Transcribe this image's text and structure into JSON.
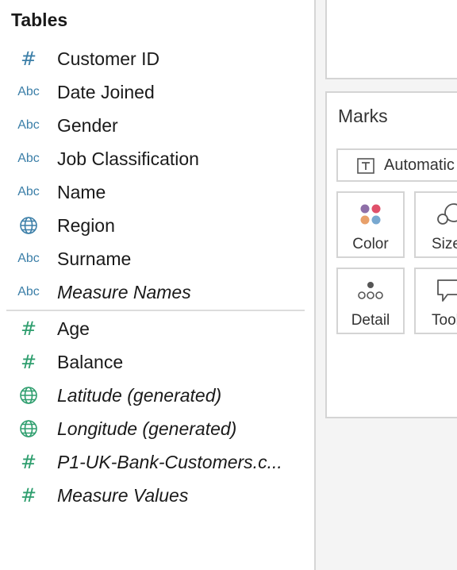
{
  "data_pane": {
    "header": "Tables",
    "dimensions": [
      {
        "name": "Customer ID",
        "italic": false,
        "icon": "hash-icon"
      },
      {
        "name": "Date Joined",
        "italic": false,
        "icon": "abc-icon"
      },
      {
        "name": "Gender",
        "italic": false,
        "icon": "abc-icon"
      },
      {
        "name": "Job Classification",
        "italic": false,
        "icon": "abc-icon"
      },
      {
        "name": "Name",
        "italic": false,
        "icon": "abc-icon"
      },
      {
        "name": "Region",
        "italic": false,
        "icon": "globe-icon"
      },
      {
        "name": "Surname",
        "italic": false,
        "icon": "abc-icon"
      },
      {
        "name": "Measure Names",
        "italic": true,
        "icon": "abc-icon"
      }
    ],
    "measures": [
      {
        "name": "Age",
        "italic": false,
        "icon": "hash-icon"
      },
      {
        "name": "Balance",
        "italic": false,
        "icon": "hash-icon"
      },
      {
        "name": "Latitude (generated)",
        "italic": true,
        "icon": "globe-icon"
      },
      {
        "name": "Longitude (generated)",
        "italic": true,
        "icon": "globe-icon"
      },
      {
        "name": "P1-UK-Bank-Customers.c...",
        "italic": true,
        "icon": "hash-icon"
      },
      {
        "name": "Measure Values",
        "italic": true,
        "icon": "hash-icon"
      }
    ],
    "abc_glyph": "Abc",
    "hash_glyph": "#",
    "colors": {
      "dimension_icon": "#3c7fa8",
      "measure_icon": "#2e9e6e"
    }
  },
  "marks_card": {
    "title": "Marks",
    "mark_type": "Automatic",
    "buttons": {
      "color": "Color",
      "size": "Size",
      "detail": "Detail",
      "tooltip": "Tooltip"
    },
    "color_dots": [
      "#8e6fa8",
      "#e0506a",
      "#e8a06a",
      "#78a8d0"
    ]
  }
}
